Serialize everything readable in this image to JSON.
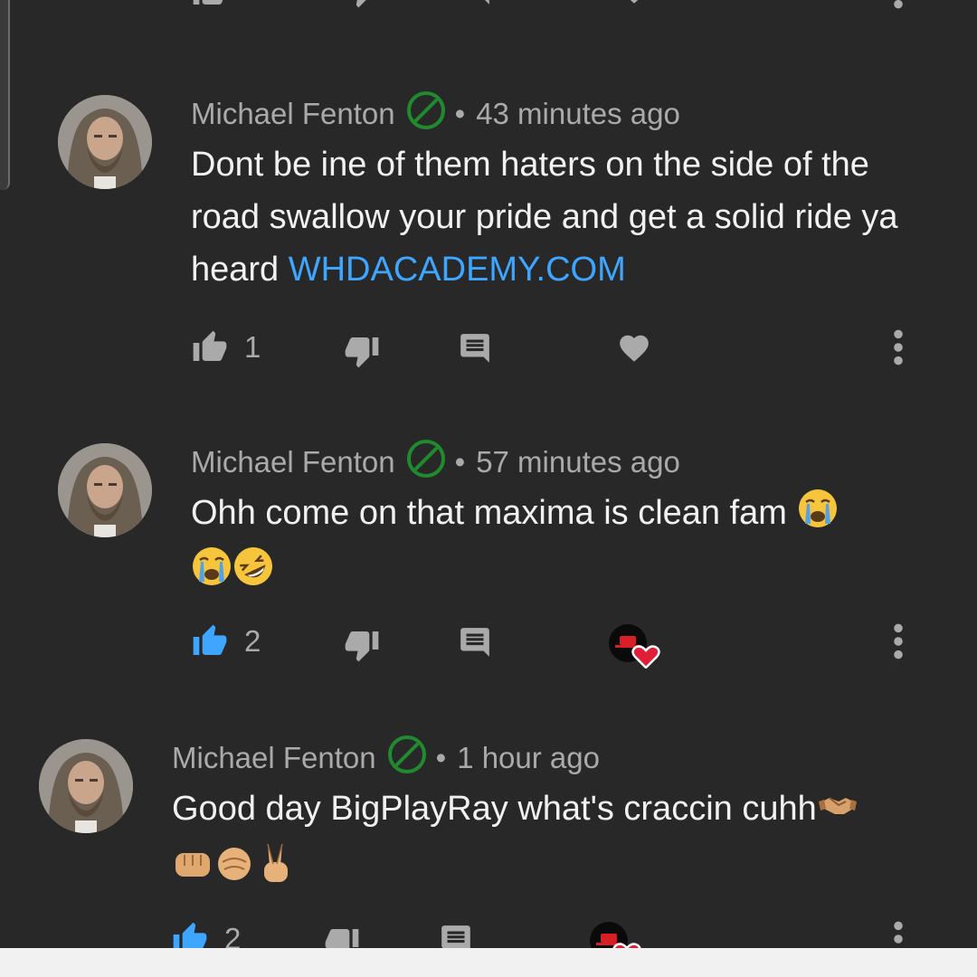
{
  "comments": [
    {
      "author": "Michael Fenton",
      "time": "43 minutes ago",
      "text_plain": "Dont be ine of them haters on the side of the road swallow your pride and get a solid ride ya heard ",
      "link": "WHDACADEMY.COM",
      "likes": "1",
      "liked": false,
      "creator_hearted": false
    },
    {
      "author": "Michael Fenton",
      "time": "57 minutes ago",
      "text_plain": "Ohh come on that maxima is clean fam",
      "likes": "2",
      "liked": true,
      "creator_hearted": true
    },
    {
      "author": "Michael Fenton",
      "time": "1 hour ago",
      "text_plain": "Good day BigPlayRay what's craccin cuhh",
      "likes": "2",
      "liked": true,
      "creator_hearted": true
    }
  ],
  "separator": "•",
  "icons": {
    "like": "thumbs-up-icon",
    "dislike": "thumbs-down-icon",
    "reply": "reply-icon",
    "heart": "heart-icon",
    "more": "more-vert-icon",
    "verified": "no-symbol-badge-icon",
    "emojis_2": [
      "crying-face",
      "crying-face",
      "rofl-face"
    ],
    "emojis_3": [
      "handshake",
      "fist-bump",
      "fist-bump",
      "victory-hand"
    ]
  },
  "colors": {
    "background": "#282828",
    "meta_text": "#aaaaaa",
    "body_text": "#f1f1f1",
    "link": "#3ea6ff",
    "liked_blue": "#3ea6ff",
    "badge_green": "#1f8a2e",
    "heart_red": "#e01e37"
  }
}
